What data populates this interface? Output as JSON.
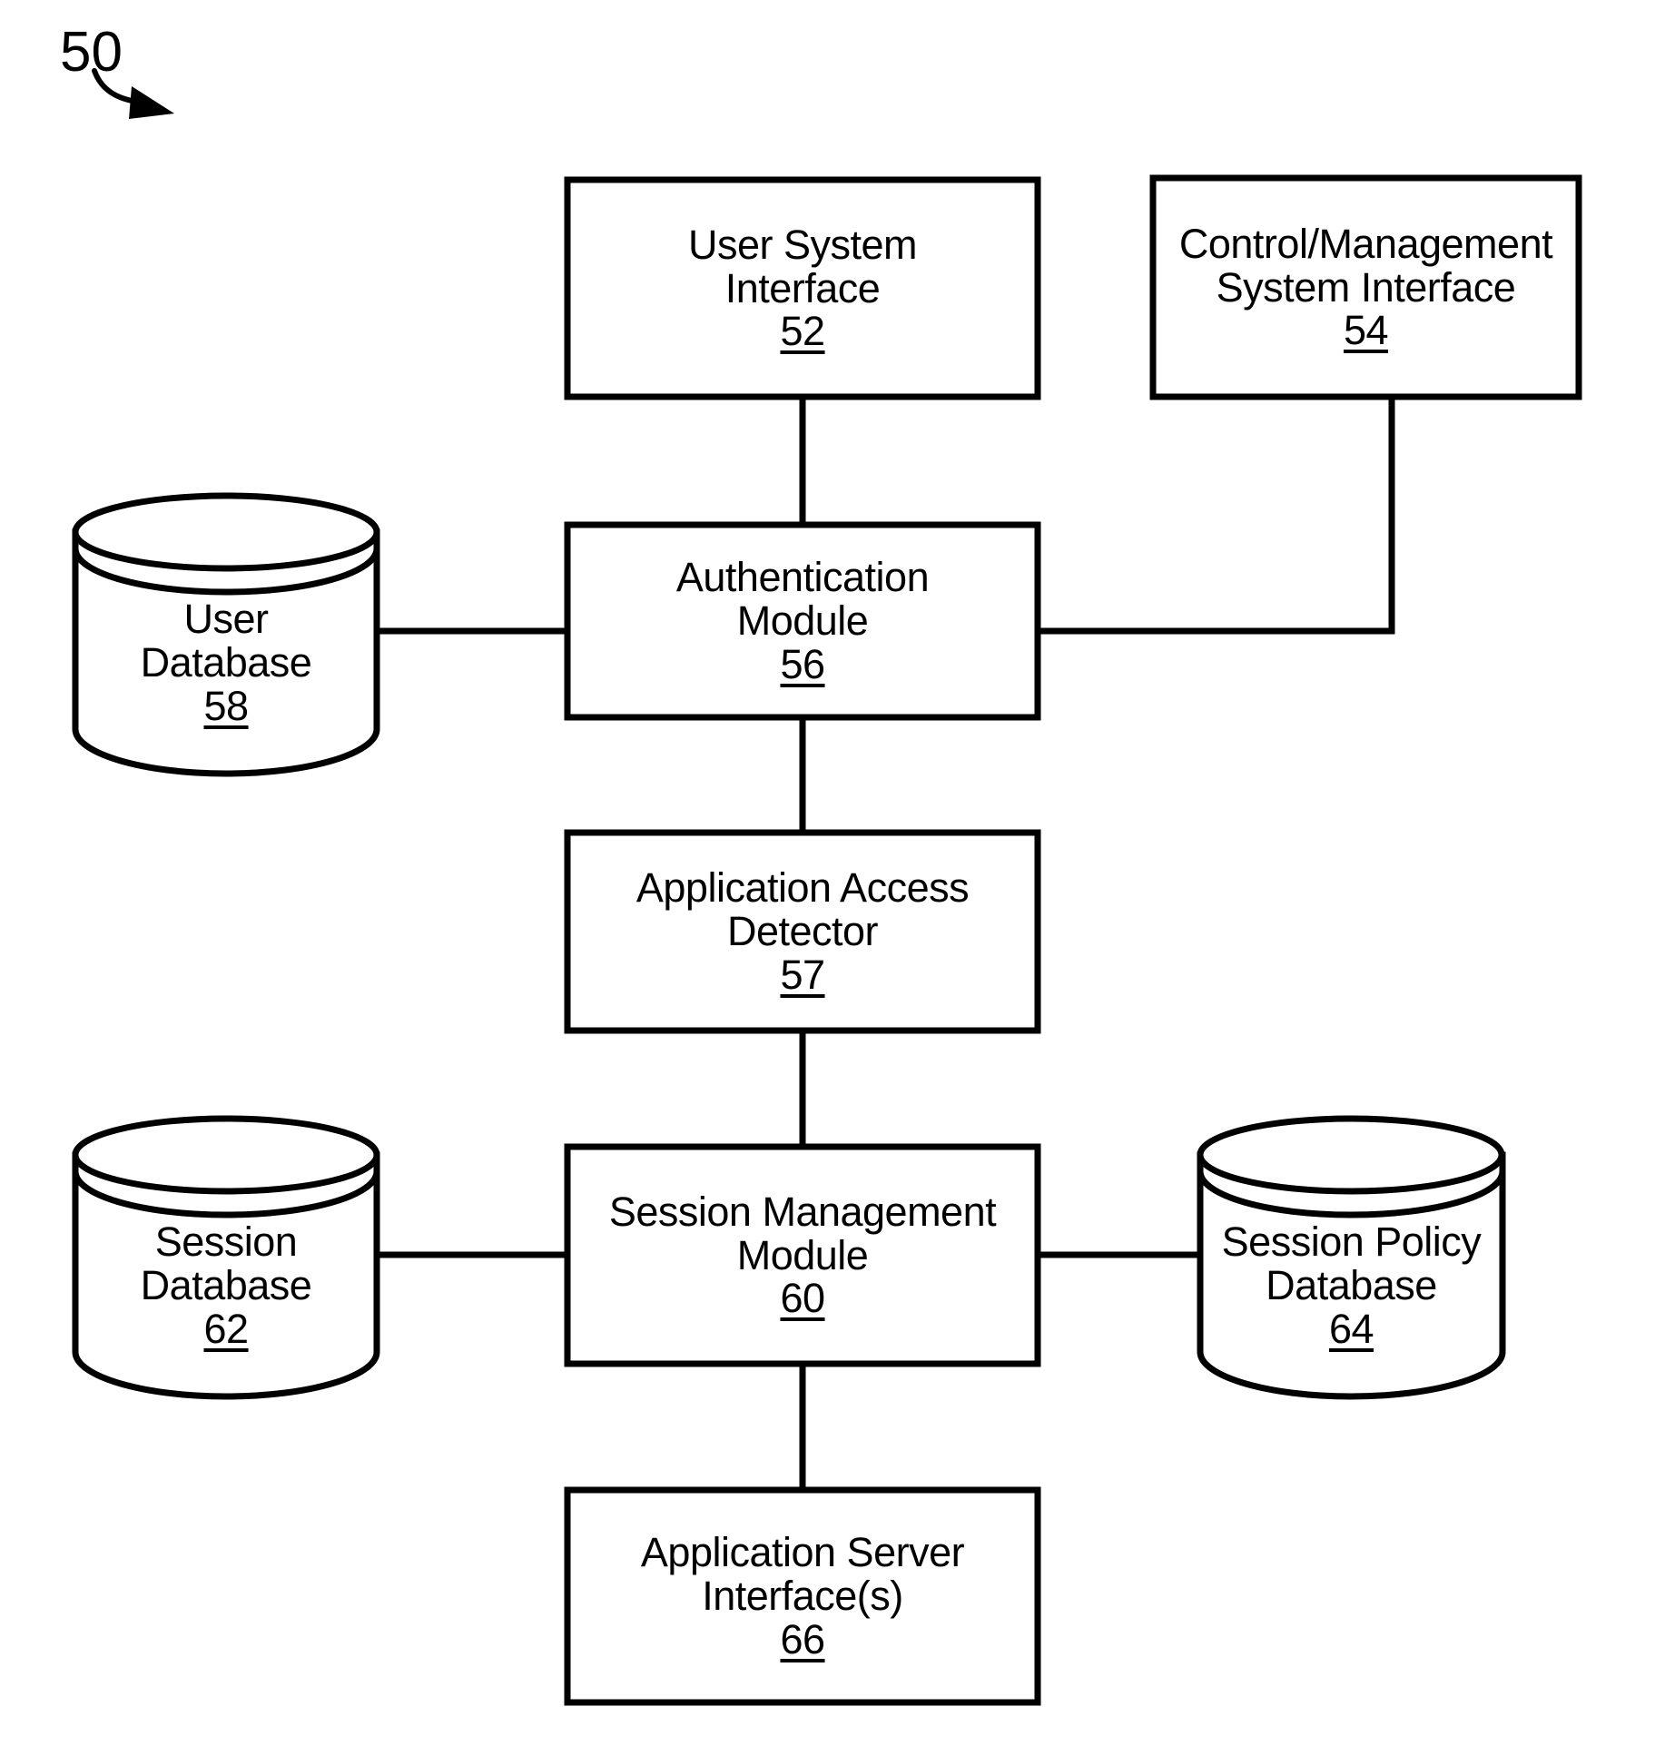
{
  "figure": {
    "number": "50",
    "pointer": "curved-arrow"
  },
  "nodes": [
    {
      "id": "user-system-interface",
      "shape": "box",
      "lines": [
        "User System",
        "Interface"
      ],
      "ref": "52"
    },
    {
      "id": "control-management-system-interface",
      "shape": "box",
      "lines": [
        "Control/Management",
        "System Interface"
      ],
      "ref": "54"
    },
    {
      "id": "authentication-module",
      "shape": "box",
      "lines": [
        "Authentication",
        "Module"
      ],
      "ref": "56"
    },
    {
      "id": "user-database",
      "shape": "cylinder",
      "lines": [
        "User",
        "Database"
      ],
      "ref": "58"
    },
    {
      "id": "application-access-detector",
      "shape": "box",
      "lines": [
        "Application Access",
        "Detector"
      ],
      "ref": "57"
    },
    {
      "id": "session-management-module",
      "shape": "box",
      "lines": [
        "Session Management",
        "Module"
      ],
      "ref": "60"
    },
    {
      "id": "session-database",
      "shape": "cylinder",
      "lines": [
        "Session",
        "Database"
      ],
      "ref": "62"
    },
    {
      "id": "session-policy-database",
      "shape": "cylinder",
      "lines": [
        "Session Policy",
        "Database"
      ],
      "ref": "64"
    },
    {
      "id": "application-server-interface",
      "shape": "box",
      "lines": [
        "Application Server",
        "Interface(s)"
      ],
      "ref": "66"
    }
  ],
  "connections": [
    {
      "from": "user-system-interface",
      "to": "authentication-module",
      "style": "straight-vertical"
    },
    {
      "from": "control-management-system-interface",
      "to": "authentication-module",
      "style": "elbow"
    },
    {
      "from": "user-database",
      "to": "authentication-module",
      "style": "straight-horizontal"
    },
    {
      "from": "authentication-module",
      "to": "application-access-detector",
      "style": "straight-vertical"
    },
    {
      "from": "application-access-detector",
      "to": "session-management-module",
      "style": "straight-vertical"
    },
    {
      "from": "session-database",
      "to": "session-management-module",
      "style": "straight-horizontal"
    },
    {
      "from": "session-management-module",
      "to": "session-policy-database",
      "style": "straight-horizontal"
    },
    {
      "from": "session-management-module",
      "to": "application-server-interface",
      "style": "straight-vertical"
    }
  ],
  "style": {
    "stroke": "#000000",
    "background": "#ffffff"
  }
}
